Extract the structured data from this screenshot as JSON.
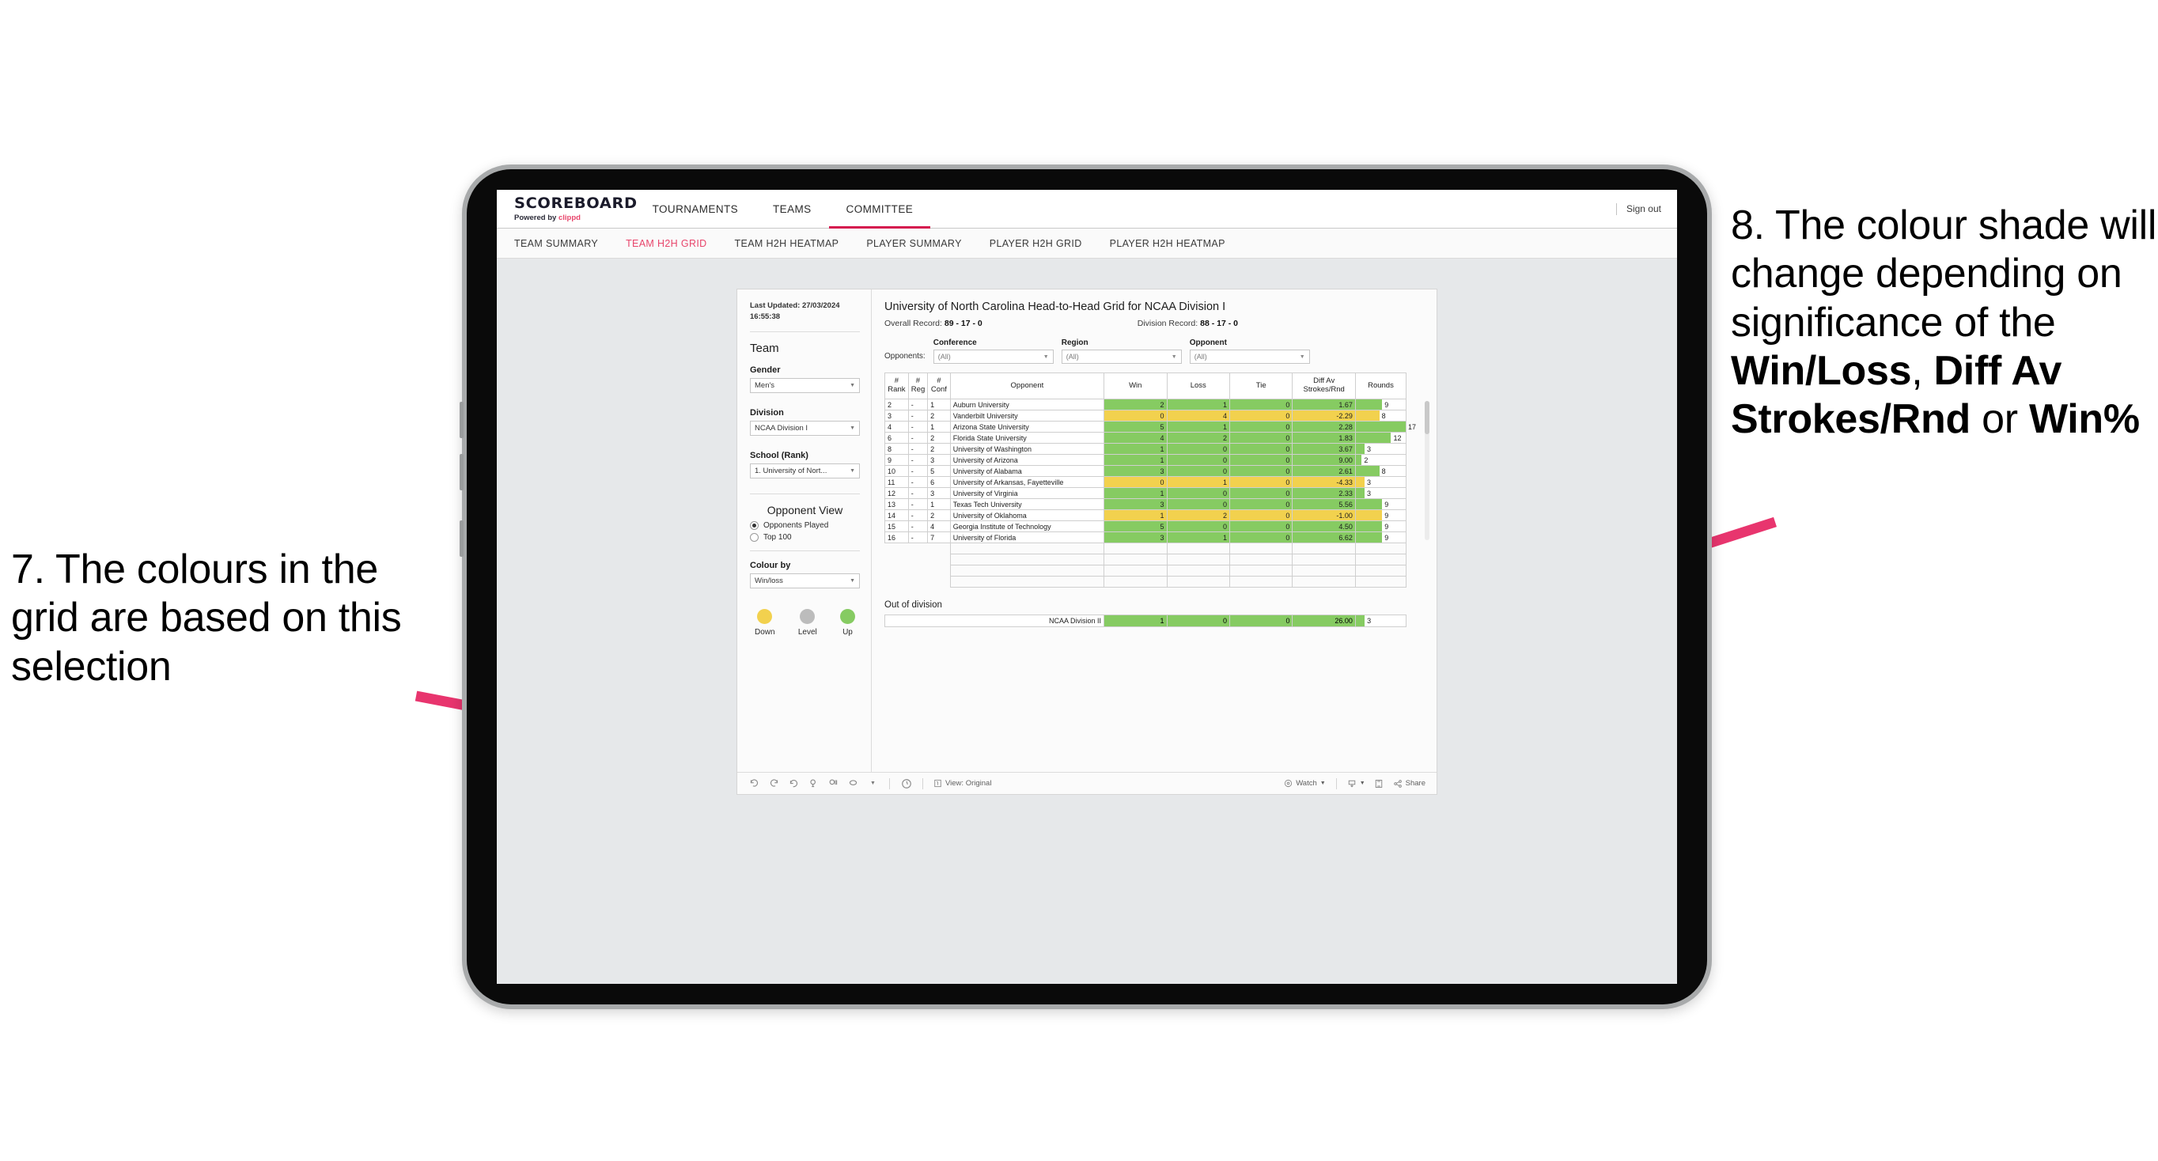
{
  "annotations": {
    "left": {
      "number": "7.",
      "text": "The colours in the grid are based on this selection"
    },
    "right": {
      "number": "8.",
      "part1": "The colour shade will change depending on significance of the ",
      "bold1": "Win/Loss",
      "mid1": ", ",
      "bold2": "Diff Av Strokes/Rnd",
      "mid2": " or ",
      "bold3": "Win%"
    },
    "arrow_color": "#e8356e"
  },
  "header": {
    "brand_title": "SCOREBOARD",
    "brand_sub_prefix": "Powered by ",
    "brand_sub_accent": "clippd",
    "nav": [
      {
        "label": "TOURNAMENTS",
        "active": false
      },
      {
        "label": "TEAMS",
        "active": false
      },
      {
        "label": "COMMITTEE",
        "active": true
      }
    ],
    "sign_out": "Sign out"
  },
  "subnav": [
    {
      "label": "TEAM SUMMARY",
      "active": false
    },
    {
      "label": "TEAM H2H GRID",
      "active": true
    },
    {
      "label": "TEAM H2H HEATMAP",
      "active": false
    },
    {
      "label": "PLAYER SUMMARY",
      "active": false
    },
    {
      "label": "PLAYER H2H GRID",
      "active": false
    },
    {
      "label": "PLAYER H2H HEATMAP",
      "active": false
    }
  ],
  "sidebar": {
    "last_updated": "Last Updated: 27/03/2024 16:55:38",
    "team_heading": "Team",
    "gender_label": "Gender",
    "gender_value": "Men's",
    "division_label": "Division",
    "division_value": "NCAA Division I",
    "school_label": "School (Rank)",
    "school_value": "1. University of Nort...",
    "opponent_view_heading": "Opponent View",
    "radio_opponents_played": "Opponents Played",
    "radio_top_100": "Top 100",
    "colour_by_label": "Colour by",
    "colour_by_value": "Win/loss",
    "legend": [
      {
        "label": "Down",
        "color": "#f2d14e"
      },
      {
        "label": "Level",
        "color": "#bcbcbc"
      },
      {
        "label": "Up",
        "color": "#86cb62"
      }
    ]
  },
  "main": {
    "title": "University of North Carolina Head-to-Head Grid for NCAA Division I",
    "overall_record_label": "Overall Record: ",
    "overall_record_value": "89 - 17 - 0",
    "division_record_label": "Division Record: ",
    "division_record_value": "88 - 17 - 0",
    "opponents_lead": "Opponents:",
    "filters": [
      {
        "label": "Conference",
        "value": "(All)"
      },
      {
        "label": "Region",
        "value": "(All)"
      },
      {
        "label": "Opponent",
        "value": "(All)"
      }
    ],
    "table_headers": [
      "# Rank",
      "# Reg",
      "# Conf",
      "Opponent",
      "Win",
      "Loss",
      "Tie",
      "Diff Av Strokes/Rnd",
      "Rounds"
    ],
    "out_of_division_title": "Out of division"
  },
  "chart_data": {
    "type": "table",
    "title": "University of North Carolina Head-to-Head Grid for NCAA Division I",
    "columns": [
      "#Rank",
      "#Reg",
      "#Conf",
      "Opponent",
      "Win",
      "Loss",
      "Tie",
      "Diff Av Strokes/Rnd",
      "Rounds"
    ],
    "colour_scale": {
      "up": "#86cb62",
      "level": "#bcbcbc",
      "down": "#f2d14e"
    },
    "rounds_max": 17,
    "rows": [
      {
        "rank": "2",
        "reg": "-",
        "conf": "1",
        "opponent": "Auburn University",
        "win": 2,
        "loss": 1,
        "tie": 0,
        "diff": "1.67",
        "rounds": 9,
        "state": "up"
      },
      {
        "rank": "3",
        "reg": "-",
        "conf": "2",
        "opponent": "Vanderbilt University",
        "win": 0,
        "loss": 4,
        "tie": 0,
        "diff": "-2.29",
        "rounds": 8,
        "state": "down"
      },
      {
        "rank": "4",
        "reg": "-",
        "conf": "1",
        "opponent": "Arizona State University",
        "win": 5,
        "loss": 1,
        "tie": 0,
        "diff": "2.28",
        "rounds": 17,
        "state": "up"
      },
      {
        "rank": "6",
        "reg": "-",
        "conf": "2",
        "opponent": "Florida State University",
        "win": 4,
        "loss": 2,
        "tie": 0,
        "diff": "1.83",
        "rounds": 12,
        "state": "up"
      },
      {
        "rank": "8",
        "reg": "-",
        "conf": "2",
        "opponent": "University of Washington",
        "win": 1,
        "loss": 0,
        "tie": 0,
        "diff": "3.67",
        "rounds": 3,
        "state": "up"
      },
      {
        "rank": "9",
        "reg": "-",
        "conf": "3",
        "opponent": "University of Arizona",
        "win": 1,
        "loss": 0,
        "tie": 0,
        "diff": "9.00",
        "rounds": 2,
        "state": "up"
      },
      {
        "rank": "10",
        "reg": "-",
        "conf": "5",
        "opponent": "University of Alabama",
        "win": 3,
        "loss": 0,
        "tie": 0,
        "diff": "2.61",
        "rounds": 8,
        "state": "up"
      },
      {
        "rank": "11",
        "reg": "-",
        "conf": "6",
        "opponent": "University of Arkansas, Fayetteville",
        "win": 0,
        "loss": 1,
        "tie": 0,
        "diff": "-4.33",
        "rounds": 3,
        "state": "down"
      },
      {
        "rank": "12",
        "reg": "-",
        "conf": "3",
        "opponent": "University of Virginia",
        "win": 1,
        "loss": 0,
        "tie": 0,
        "diff": "2.33",
        "rounds": 3,
        "state": "up"
      },
      {
        "rank": "13",
        "reg": "-",
        "conf": "1",
        "opponent": "Texas Tech University",
        "win": 3,
        "loss": 0,
        "tie": 0,
        "diff": "5.56",
        "rounds": 9,
        "state": "up"
      },
      {
        "rank": "14",
        "reg": "-",
        "conf": "2",
        "opponent": "University of Oklahoma",
        "win": 1,
        "loss": 2,
        "tie": 0,
        "diff": "-1.00",
        "rounds": 9,
        "state": "down"
      },
      {
        "rank": "15",
        "reg": "-",
        "conf": "4",
        "opponent": "Georgia Institute of Technology",
        "win": 5,
        "loss": 0,
        "tie": 0,
        "diff": "4.50",
        "rounds": 9,
        "state": "up"
      },
      {
        "rank": "16",
        "reg": "-",
        "conf": "7",
        "opponent": "University of Florida",
        "win": 3,
        "loss": 1,
        "tie": 0,
        "diff": "6.62",
        "rounds": 9,
        "state": "up"
      }
    ],
    "out_of_division": [
      {
        "opponent": "NCAA Division II",
        "win": 1,
        "loss": 0,
        "tie": 0,
        "diff": "26.00",
        "rounds": 3,
        "state": "up"
      }
    ]
  },
  "toolbar": {
    "undo": "undo-icon",
    "redo": "redo-icon",
    "revert": "revert-icon",
    "refresh": "refresh-icon",
    "pause": "pause-icon",
    "view_label": "View: Original",
    "watch_label": "Watch",
    "share_label": "Share"
  }
}
